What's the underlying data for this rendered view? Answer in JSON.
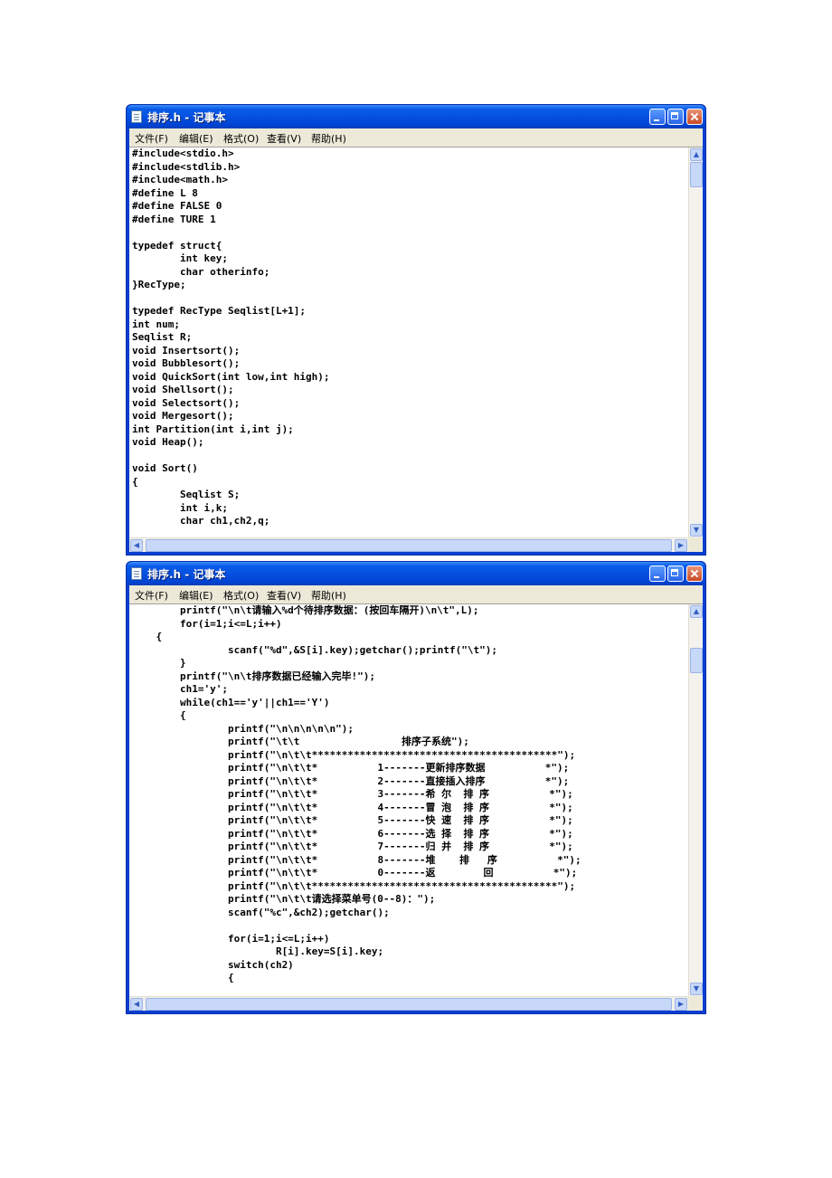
{
  "windows": [
    {
      "title": "排序.h - 记事本",
      "menu": [
        "文件(F)",
        "编辑(E)",
        "格式(O)",
        "查看(V)",
        "帮助(H)"
      ],
      "code": "#include<stdio.h>\n#include<stdlib.h>\n#include<math.h>\n#define L 8\n#define FALSE 0\n#define TURE 1\n\ntypedef struct{\n        int key;\n        char otherinfo;\n}RecType;\n\ntypedef RecType Seqlist[L+1];\nint num;\nSeqlist R;\nvoid Insertsort();\nvoid Bubblesort();\nvoid QuickSort(int low,int high);\nvoid Shellsort();\nvoid Selectsort();\nvoid Mergesort();\nint Partition(int i,int j);\nvoid Heap();\n\nvoid Sort()\n{\n        Seqlist S;\n        int i,k;\n        char ch1,ch2,q;"
    },
    {
      "title": "排序.h - 记事本",
      "menu": [
        "文件(F)",
        "编辑(E)",
        "格式(O)",
        "查看(V)",
        "帮助(H)"
      ],
      "code": "        printf(\"\\n\\t请输入%d个待排序数据：(按回车隔开)\\n\\t\",L);\n        for(i=1;i<=L;i++)\n    {\n                scanf(\"%d\",&S[i].key);getchar();printf(\"\\t\");\n        }\n        printf(\"\\n\\t排序数据已经输入完毕!\");\n        ch1='y';\n        while(ch1=='y'||ch1=='Y')\n        {\n                printf(\"\\n\\n\\n\\n\\n\");\n                printf(\"\\t\\t                 排序子系统\");\n                printf(\"\\n\\t\\t*****************************************\");\n                printf(\"\\n\\t\\t*          1-------更新排序数据          *\");\n                printf(\"\\n\\t\\t*          2-------直接插入排序          *\");\n                printf(\"\\n\\t\\t*          3-------希 尔  排 序          *\");\n                printf(\"\\n\\t\\t*          4-------冒 泡  排 序          *\");\n                printf(\"\\n\\t\\t*          5-------快 速  排 序          *\");\n                printf(\"\\n\\t\\t*          6-------选 择  排 序          *\");\n                printf(\"\\n\\t\\t*          7-------归 并  排 序          *\");\n                printf(\"\\n\\t\\t*          8-------堆    排   序          *\");\n                printf(\"\\n\\t\\t*          0-------返        回          *\");\n                printf(\"\\n\\t\\t*****************************************\");\n                printf(\"\\n\\t\\t请选择菜单号(0--8)：\");\n                scanf(\"%c\",&ch2);getchar();\n\n                for(i=1;i<=L;i++)\n                        R[i].key=S[i].key;\n                switch(ch2)\n                {"
    }
  ]
}
